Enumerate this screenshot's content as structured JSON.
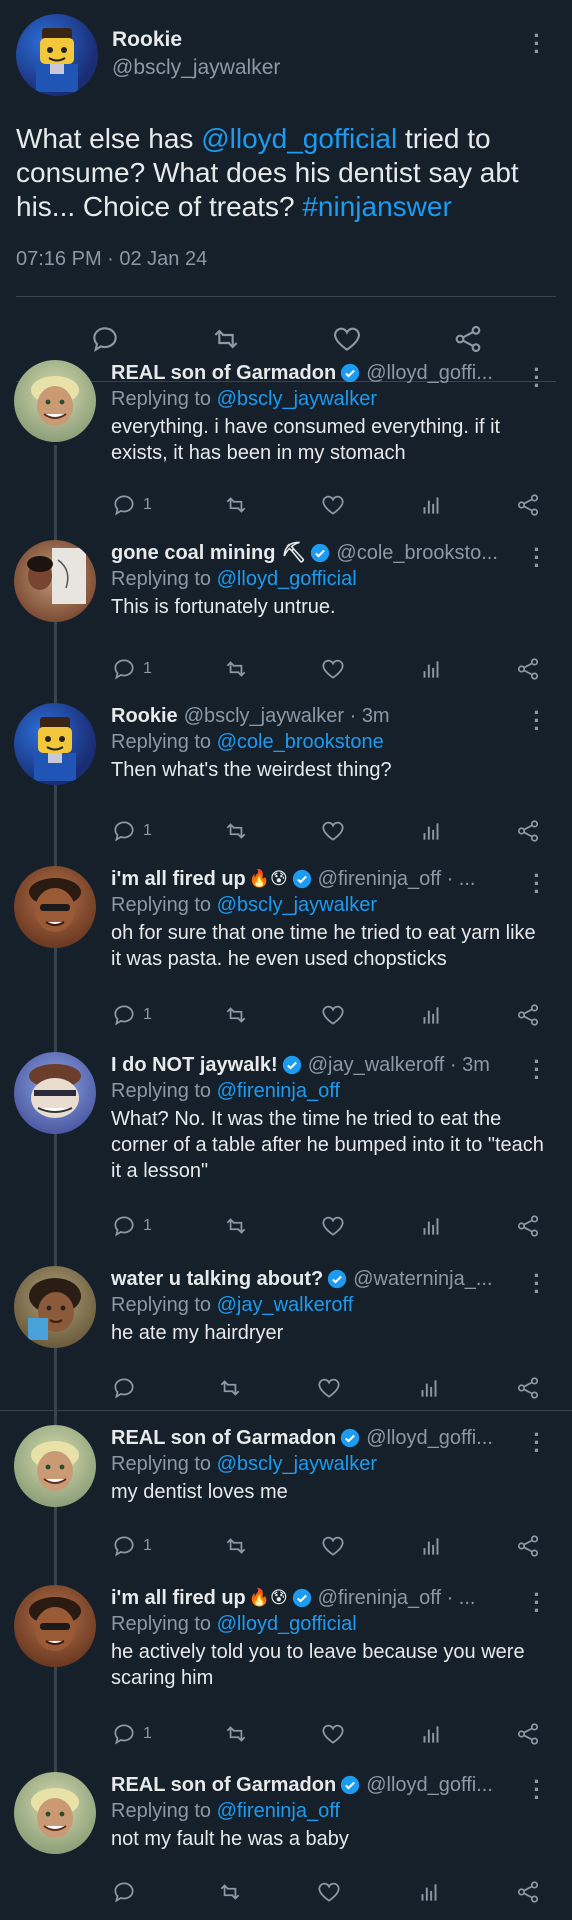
{
  "main_tweet": {
    "display_name": "Rookie",
    "handle": "@bscly_jaywalker",
    "text_parts": [
      "What else has ",
      "@lloyd_gofficial",
      " tried to consume? What does his dentist say abt his... Choice of treats? ",
      "#ninjanswer"
    ],
    "timestamp": "07:16 PM · 02 Jan 24"
  },
  "replies": [
    {
      "name": "REAL son of Garmadon",
      "handle": "@lloyd_goffi...",
      "replying_prefix": "Replying to ",
      "replying_to": "@bscly_jaywalker",
      "text": "everything. i have consumed everything. if it exists, it has been in my stomach",
      "reply_count": "1",
      "avatar": "lloyd"
    },
    {
      "name": "gone coal mining ⛏",
      "handle": "@cole_brooksto...",
      "replying_prefix": "Replying to ",
      "replying_to": "@lloyd_gofficial",
      "text": "This is fortunately untrue.",
      "reply_count": "1",
      "avatar": "cole"
    },
    {
      "name": "Rookie",
      "handle": "@bscly_jaywalker · 3m",
      "replying_prefix": "Replying to ",
      "replying_to": "@cole_brookstone",
      "text": "Then what's the weirdest thing?",
      "reply_count": "1",
      "avatar": "rookie"
    },
    {
      "name": "i'm all fired up",
      "emojis": "🔥😰",
      "handle": "@fireninja_off · ...",
      "replying_prefix": "Replying to ",
      "replying_to": "@bscly_jaywalker",
      "text": "oh for sure that one time he tried to eat yarn like it was pasta. he even used chopsticks",
      "reply_count": "1",
      "avatar": "kai"
    },
    {
      "name": "I do NOT jaywalk!",
      "handle": "@jay_walkeroff · 3m",
      "replying_prefix": "Replying to ",
      "replying_to": "@fireninja_off",
      "text": "What? No. It was the time he tried to eat the corner of a table after he bumped into it to \"teach it a lesson\"",
      "reply_count": "1",
      "avatar": "jay"
    },
    {
      "name": "water u talking about?",
      "handle": "@waterninja_...",
      "replying_prefix": "Replying to ",
      "replying_to": "@jay_walkeroff",
      "text": "he ate my hairdryer",
      "reply_count": "",
      "avatar": "nya"
    },
    {
      "name": "REAL son of Garmadon",
      "handle": "@lloyd_goffi...",
      "replying_prefix": "Replying to ",
      "replying_to": "@bscly_jaywalker",
      "text": "my dentist loves me",
      "reply_count": "1",
      "avatar": "lloyd"
    },
    {
      "name": "i'm all fired up",
      "emojis": "🔥😰",
      "handle": "@fireninja_off · ...",
      "replying_prefix": "Replying to ",
      "replying_to": "@lloyd_gofficial",
      "text": "he actively told you to leave because you were scaring him",
      "reply_count": "1",
      "avatar": "kai"
    },
    {
      "name": "REAL son of Garmadon",
      "handle": "@lloyd_goffi...",
      "replying_prefix": "Replying to ",
      "replying_to": "@fireninja_off",
      "text": "not my fault he was a baby",
      "reply_count": "",
      "avatar": "lloyd"
    }
  ],
  "colors": {
    "background": "#15202b",
    "text": "#e7e9ea",
    "secondary": "#8b98a5",
    "link": "#1d9bf0",
    "divider": "#38444d"
  },
  "icons": {
    "reply": "reply-icon",
    "retweet": "retweet-icon",
    "like": "heart-icon",
    "views": "views-icon",
    "share": "share-icon",
    "more": "more-dots-icon",
    "verified": "verified-badge-icon"
  }
}
